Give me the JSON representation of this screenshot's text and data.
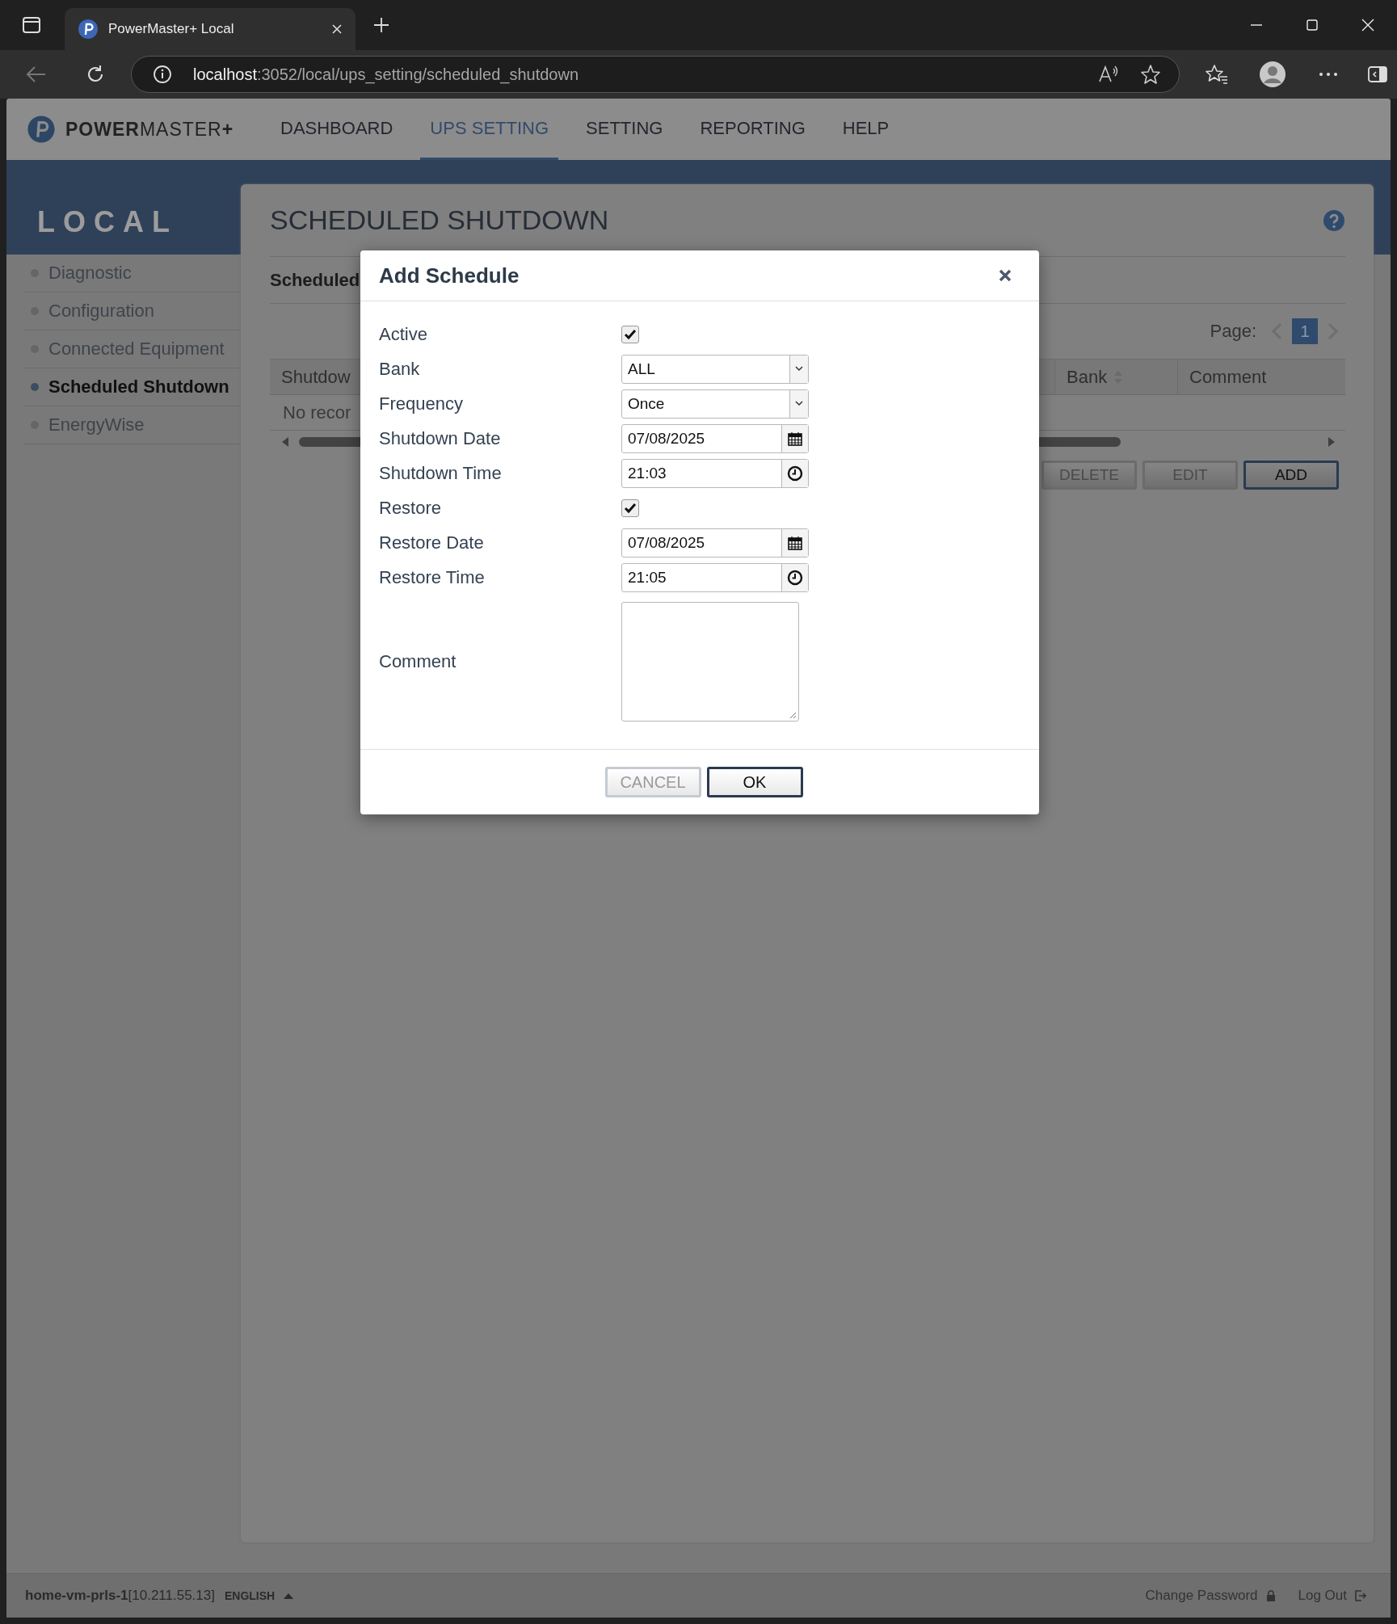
{
  "browser": {
    "tab_title": "PowerMaster+ Local",
    "url_host": "localhost",
    "url_path": ":3052/local/ups_setting/scheduled_shutdown"
  },
  "app": {
    "logo": "**POWER**MASTER**+**"
  },
  "nav": [
    {
      "label": "DASHBOARD",
      "selected": false
    },
    {
      "label": "UPS SETTING",
      "selected": true
    },
    {
      "label": "SETTING",
      "selected": false
    },
    {
      "label": "REPORTING",
      "selected": false
    },
    {
      "label": "HELP",
      "selected": false
    }
  ],
  "sidebar": {
    "title": "LOCAL",
    "items": [
      {
        "label": "Diagnostic",
        "selected": false
      },
      {
        "label": "Configuration",
        "selected": false
      },
      {
        "label": "Connected Equipment",
        "selected": false
      },
      {
        "label": "Scheduled Shutdown",
        "selected": true
      },
      {
        "label": "EnergyWise",
        "selected": false
      }
    ]
  },
  "content": {
    "title": "SCHEDULED SHUTDOWN",
    "section": "Scheduled",
    "pager": {
      "label": "Page:",
      "pages": [
        {
          "label": "1",
          "selected": true
        }
      ]
    },
    "table": {
      "columns": [
        {
          "label": "Shutdow",
          "sortable": false
        },
        {
          "label": "Bank",
          "sortable": true
        },
        {
          "label": "Comment",
          "sortable": false
        }
      ],
      "empty": "No recor"
    },
    "buttons": [
      {
        "label": "DELETE",
        "disabled": true
      },
      {
        "label": "EDIT",
        "disabled": true
      },
      {
        "label": "ADD",
        "disabled": false
      }
    ]
  },
  "dialog": {
    "title": "Add Schedule",
    "fields": [
      {
        "label": "Active",
        "kind": "checkbox",
        "checked": true
      },
      {
        "label": "Bank",
        "kind": "select",
        "value": "ALL"
      },
      {
        "label": "Frequency",
        "kind": "select",
        "value": "Once"
      },
      {
        "label": "Shutdown Date",
        "kind": "date",
        "value": "07/08/2025"
      },
      {
        "label": "Shutdown Time",
        "kind": "time",
        "value": "21:03"
      },
      {
        "label": "Restore",
        "kind": "checkbox",
        "checked": true
      },
      {
        "label": "Restore Date",
        "kind": "date",
        "value": "07/08/2025"
      },
      {
        "label": "Restore Time",
        "kind": "time",
        "value": "21:05"
      },
      {
        "label": "Comment",
        "kind": "textarea"
      }
    ],
    "buttons": [
      {
        "label": "CANCEL",
        "disabled": true
      },
      {
        "label": "OK",
        "disabled": false
      }
    ]
  },
  "footer": {
    "host": "**home-vm-prls-1**[10.211.55.13]",
    "language": "ENGLISH",
    "links": [
      {
        "label": "Change Password",
        "kind": "lock"
      },
      {
        "label": "Log Out",
        "kind": "logout"
      }
    ]
  }
}
